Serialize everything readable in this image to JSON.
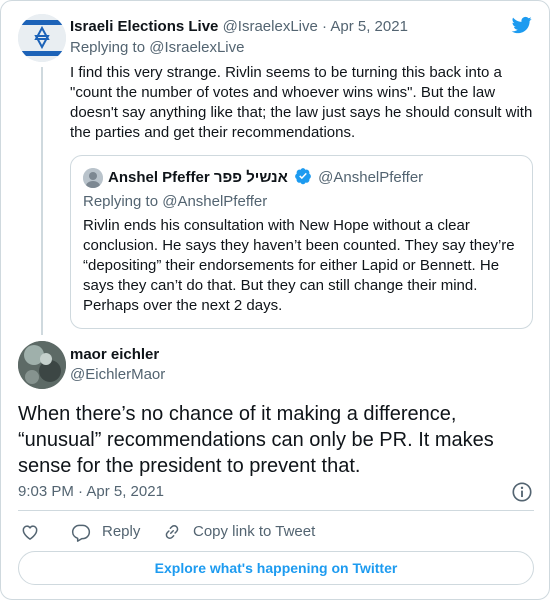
{
  "parent_tweet": {
    "author_name": "Israeli Elections Live",
    "author_handle": "@IsraelexLive",
    "date": "Apr 5, 2021",
    "replying_to": "Replying to @IsraelexLive",
    "text": "I find this very strange. Rivlin seems to be turning this back into a \"count the number of votes and whoever wins wins\". But the law doesn't say anything like that; the law just says he should consult with the parties and get their recommendations."
  },
  "quoted_tweet": {
    "author_name": "Anshel Pfeffer אנשיל פפר",
    "author_handle": "@AnshelPfeffer",
    "replying_to": "Replying to @AnshelPfeffer",
    "text": "Rivlin ends his consultation with New Hope without a clear conclusion. He says they haven’t been counted. They say they’re “depositing” their endorsements for either Lapid or Bennett. He says they can’t do that. But they can still change their mind. Perhaps over the next 2 days."
  },
  "main_tweet": {
    "author_name": "maor eichler",
    "author_handle": "@EichlerMaor",
    "text": "When there’s no chance of it making a difference, “unusual” recommendations can only be PR. It makes sense for the president to prevent that.",
    "timestamp": "9:03 PM · Apr 5, 2021"
  },
  "actions": {
    "reply_label": "Reply",
    "copy_link_label": "Copy link to Tweet"
  },
  "explore_label": "Explore what's happening on Twitter",
  "icons": {
    "brand": "twitter-bird-icon",
    "like": "heart-icon",
    "reply": "reply-bubble-icon",
    "copy": "link-icon",
    "info": "info-icon",
    "verified": "verified-badge-icon"
  },
  "colors": {
    "accent": "#1d9bf0",
    "text": "#0f1419",
    "muted": "#536471",
    "border": "#cfd9de"
  }
}
